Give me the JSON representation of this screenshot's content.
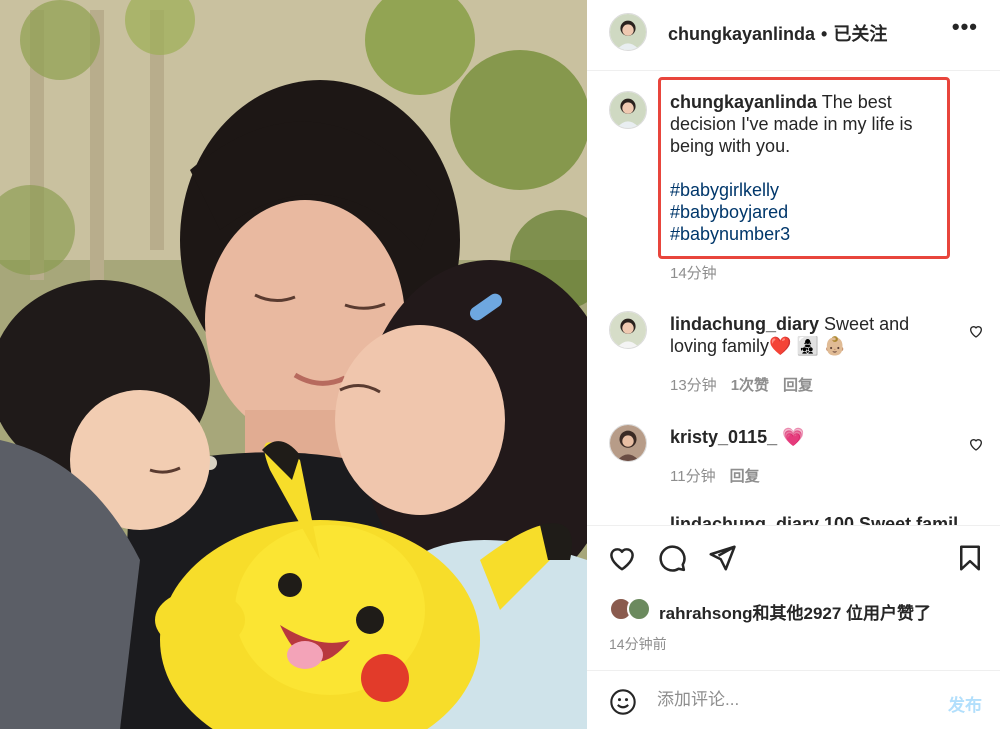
{
  "photo": {
    "alt_icon": "family-photo"
  },
  "header": {
    "username": "chungkayanlinda",
    "separator": "•",
    "follow_status": "已关注",
    "more_label": "•••"
  },
  "caption": {
    "username": "chungkayanlinda",
    "text": "The best decision I've made in my life is being with you.",
    "hashtags": [
      "#babygirlkelly",
      "#babyboyjared",
      "#babynumber3"
    ],
    "time": "14分钟"
  },
  "comments": [
    {
      "username": "lindachung_diary",
      "text": "Sweet and loving family❤️ 👩‍👧‍👦 👶🏼",
      "time": "13分钟",
      "likes": "1次赞",
      "reply": "回复"
    },
    {
      "username": "kristy_0115_",
      "text": "💗",
      "time": "11分钟",
      "reply": "回复"
    }
  ],
  "cut_comment": "lindachung_diary 100 Sweet famil",
  "likes": {
    "text": "rahrahsong和其他2927 位用户赞了"
  },
  "post_time": "14分钟前",
  "comment_input": {
    "placeholder": "添加评论..."
  },
  "post_button": "发布",
  "colors": {
    "highlight": "#e8453c",
    "hashtag": "#00376b",
    "post_disabled": "#b2dffc",
    "muted": "#8e8e8e"
  }
}
